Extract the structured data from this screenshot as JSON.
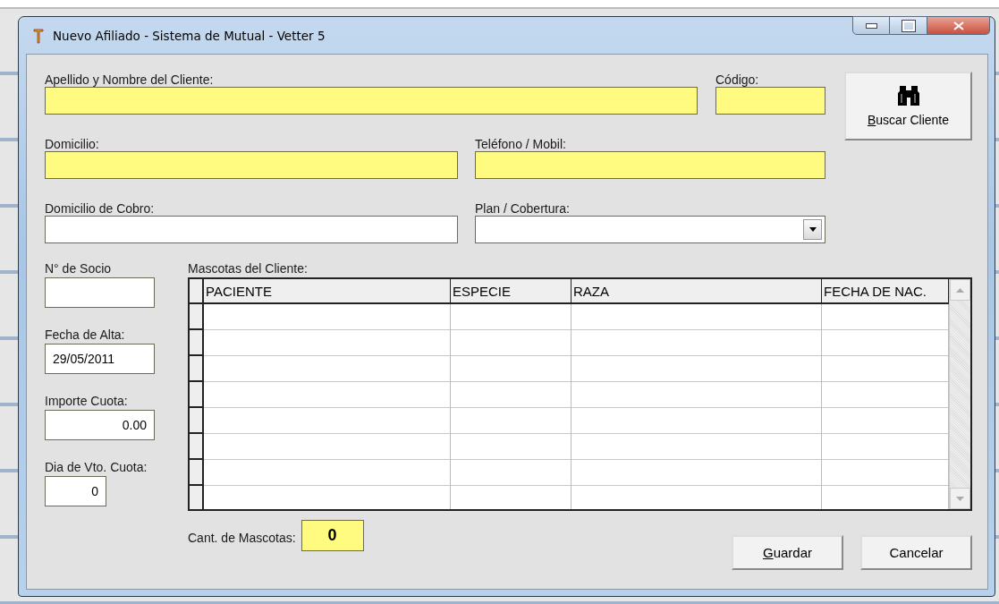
{
  "window": {
    "title": "Nuevo Afiliado - Sistema de Mutual - Vetter 5"
  },
  "client_fields": [
    {
      "label": "Apellido y Nombre del Cliente:",
      "kind": "text",
      "required": true
    },
    {
      "label": "Código:",
      "kind": "text",
      "required": true
    },
    {
      "label": "Domicilio:",
      "kind": "text",
      "required": true
    },
    {
      "label": "Teléfono / Mobil:",
      "kind": "text",
      "required": true
    },
    {
      "label": "Domicilio de Cobro:",
      "kind": "text",
      "required": false
    },
    {
      "label": "Plan / Cobertura:",
      "kind": "dropdown",
      "required": false
    }
  ],
  "search_button": {
    "label": "Buscar Cliente",
    "mnemonic": true
  },
  "side_fields": [
    {
      "label": "N° de Socio",
      "kind": "text"
    },
    {
      "label": "Fecha de Alta:",
      "kind": "date",
      "value": "29/05/2011"
    },
    {
      "label": "Importe Cuota:",
      "kind": "amount",
      "value": "0.00"
    },
    {
      "label": "Dia de Vto. Cuota:",
      "kind": "day",
      "value": "0"
    }
  ],
  "pets": {
    "label": "Mascotas del Cliente:",
    "columns": [
      "PACIENTE",
      "ESPECIE",
      "RAZA",
      "FECHA DE NAC."
    ]
  },
  "count": {
    "label": "Cant. de Mascotas:",
    "value": "0"
  },
  "buttons": [
    {
      "label": "Guardar",
      "mnemonic": true
    },
    {
      "label": "Cancelar",
      "mnemonic": false
    }
  ]
}
